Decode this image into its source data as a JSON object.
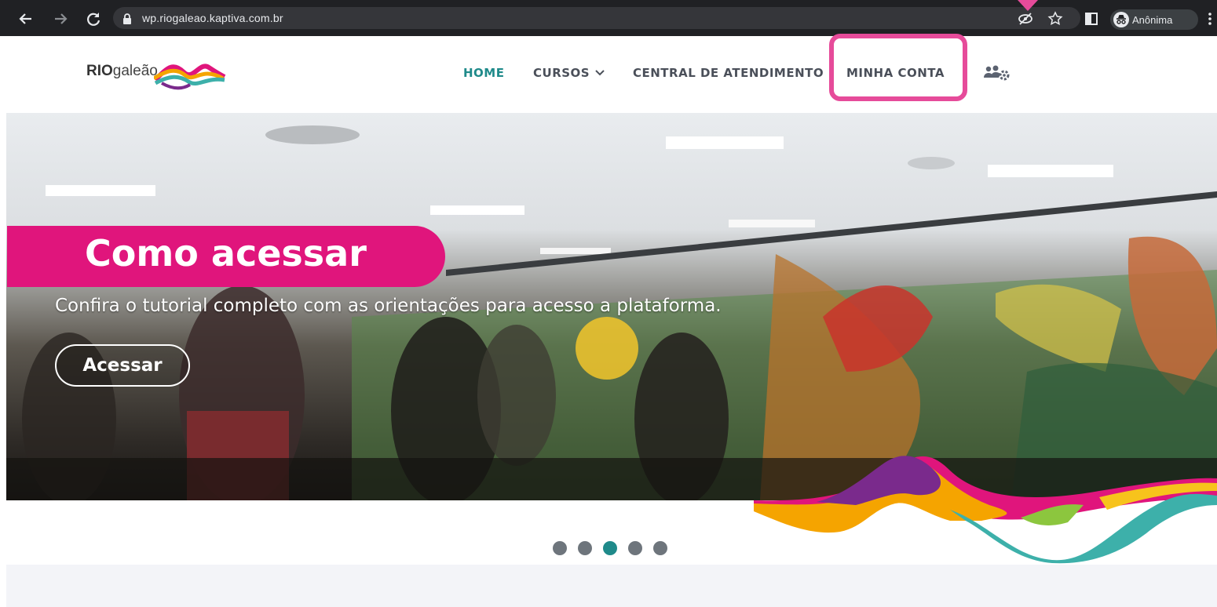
{
  "browser": {
    "url": "wp.riogaleao.kaptiva.com.br",
    "profile_label": "Anônima"
  },
  "site": {
    "logo": {
      "bold": "RIO",
      "regular": "galeão"
    },
    "menu": [
      {
        "label": "HOME",
        "active": true
      },
      {
        "label": "CURSOS",
        "has_dropdown": true
      },
      {
        "label": "CENTRAL DE ATENDIMENTO"
      },
      {
        "label": "MINHA CONTA",
        "highlighted": true
      }
    ],
    "menu_icon": "users-gear-icon"
  },
  "hero": {
    "title": "Como acessar",
    "subtitle": "Confira o tutorial completo com as orientações para acesso a plataforma.",
    "button_label": "Acessar"
  },
  "carousel": {
    "slide_count": 5,
    "active_index": 2
  },
  "colors": {
    "brand_teal": "#1f8a8a",
    "brand_pink": "#e0157c",
    "highlight": "#e64b9a",
    "chrome_dark": "#202124"
  }
}
